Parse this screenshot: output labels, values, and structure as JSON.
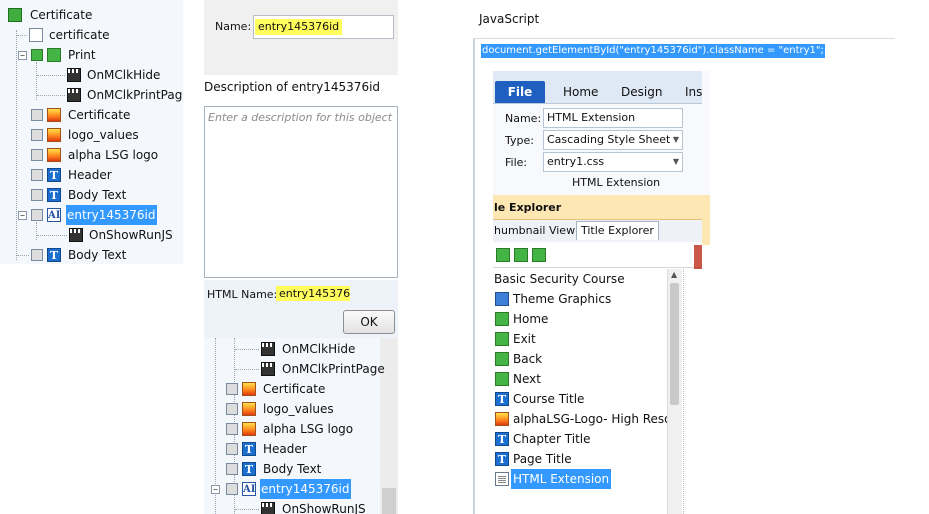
{
  "left_tree": {
    "items": [
      {
        "label": "Certificate",
        "icon": "book-icon"
      },
      {
        "label": "certificate",
        "icon": "document-icon"
      },
      {
        "label": "Print",
        "icon": "green-button-icon"
      },
      {
        "label": "OnMClkHide",
        "icon": "clapperboard-icon"
      },
      {
        "label": "OnMClkPrintPage",
        "icon": "clapperboard-icon"
      },
      {
        "label": "Certificate",
        "icon": "image-icon"
      },
      {
        "label": "logo_values",
        "icon": "image-icon"
      },
      {
        "label": "alpha LSG logo",
        "icon": "image-icon"
      },
      {
        "label": "Header",
        "icon": "text-icon"
      },
      {
        "label": "Body Text",
        "icon": "text-icon"
      },
      {
        "label": "entry145376id",
        "icon": "text-entry-icon",
        "selected": true
      },
      {
        "label": "OnShowRunJS",
        "icon": "clapperboard-icon"
      },
      {
        "label": "Body Text",
        "icon": "text-icon"
      }
    ]
  },
  "dialog": {
    "name_label": "Name:",
    "name_value": "entry145376id",
    "description_label": "Description of entry145376id",
    "description_placeholder": "Enter a description for this object",
    "html_name_label": "HTML Name:",
    "html_name_value": "entry145376",
    "ok_label": "OK",
    "highlight_color": "#fffe5c"
  },
  "mid_tree": {
    "items": [
      {
        "label": "OnMClkHide",
        "icon": "clapperboard-icon"
      },
      {
        "label": "OnMClkPrintPage",
        "icon": "clapperboard-icon"
      },
      {
        "label": "Certificate",
        "icon": "image-icon"
      },
      {
        "label": "logo_values",
        "icon": "image-icon"
      },
      {
        "label": "alpha LSG logo",
        "icon": "image-icon"
      },
      {
        "label": "Header",
        "icon": "text-icon"
      },
      {
        "label": "Body Text",
        "icon": "text-icon"
      },
      {
        "label": "entry145376id",
        "icon": "text-entry-icon",
        "selected": true
      },
      {
        "label": "OnShowRunJS",
        "icon": "clapperboard-icon"
      }
    ]
  },
  "js_panel": {
    "title": "JavaScript",
    "code": "document.getElementById(\"entry145376id\").className = \"entry1\";"
  },
  "ribbon": {
    "tabs": [
      "File",
      "Home",
      "Design",
      "Inse"
    ],
    "name_label": "Name:",
    "name_value": "HTML Extension",
    "type_label": "Type:",
    "type_value": "Cascading Style Sheet",
    "file_label": "File:",
    "file_value": "entry1.css",
    "group_label": "HTML Extension",
    "accent_color": "#1f5fbf"
  },
  "title_explorer": {
    "header": "le Explorer",
    "tabs": [
      "humbnail View",
      "Title Explorer"
    ],
    "items": [
      {
        "label": "Basic Security Course",
        "icon": ""
      },
      {
        "label": "Theme Graphics",
        "icon": "theme-icon"
      },
      {
        "label": "Home",
        "icon": "green-button-icon"
      },
      {
        "label": "Exit",
        "icon": "green-button-icon"
      },
      {
        "label": "Back",
        "icon": "green-button-icon"
      },
      {
        "label": "Next",
        "icon": "green-button-icon"
      },
      {
        "label": "Course Title",
        "icon": "text-icon"
      },
      {
        "label": "alphaLSG-Logo- High Reso",
        "icon": "image-icon"
      },
      {
        "label": "Chapter Title",
        "icon": "text-icon"
      },
      {
        "label": "Page Title",
        "icon": "text-icon"
      },
      {
        "label": "HTML Extension",
        "icon": "page-icon",
        "selected": true
      }
    ]
  }
}
